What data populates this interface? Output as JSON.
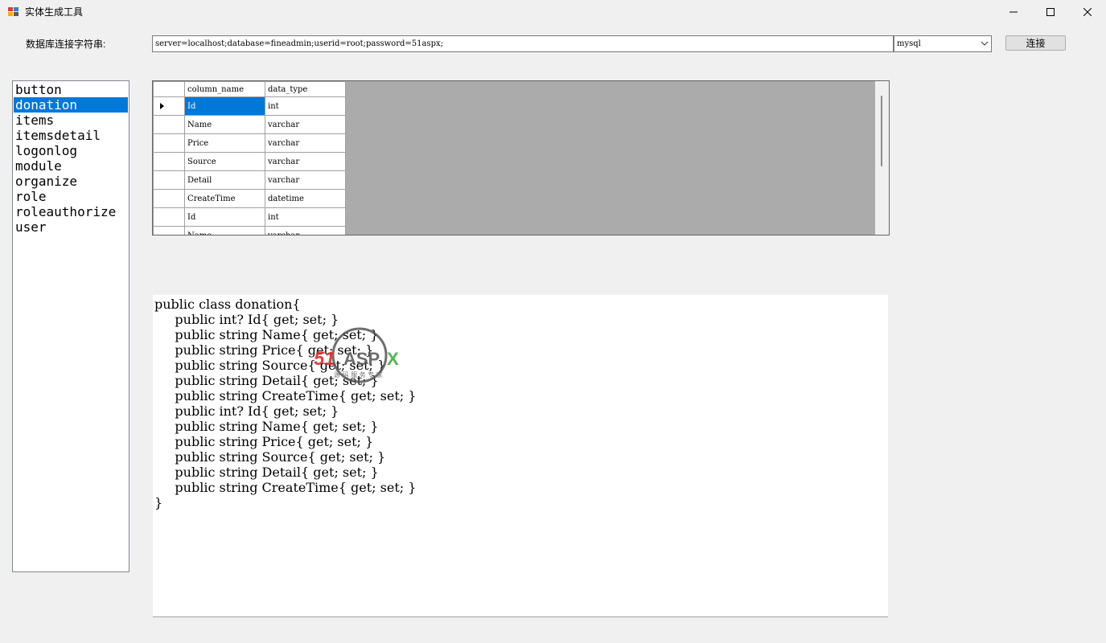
{
  "window": {
    "title": "实体生成工具",
    "controls": {
      "minimize": "minimize-icon",
      "maximize": "maximize-icon",
      "close": "close-icon"
    }
  },
  "connection": {
    "label": "数据库连接字符串:",
    "value": "server=localhost;database=fineadmin;userid=root;password=51aspx;",
    "db_type_selected": "mysql",
    "connect_label": "连接"
  },
  "tables": [
    "button",
    "donation",
    "items",
    "itemsdetail",
    "logonlog",
    "module",
    "organize",
    "role",
    "roleauthorize",
    "user"
  ],
  "selected_table": "donation",
  "grid": {
    "columns": [
      "column_name",
      "data_type"
    ],
    "rows": [
      {
        "column_name": "Id",
        "data_type": "int"
      },
      {
        "column_name": "Name",
        "data_type": "varchar"
      },
      {
        "column_name": "Price",
        "data_type": "varchar"
      },
      {
        "column_name": "Source",
        "data_type": "varchar"
      },
      {
        "column_name": "Detail",
        "data_type": "varchar"
      },
      {
        "column_name": "CreateTime",
        "data_type": "datetime"
      },
      {
        "column_name": "Id",
        "data_type": "int"
      },
      {
        "column_name": "Name",
        "data_type": "varchar"
      }
    ]
  },
  "generated_code": "public class donation{\n     public int? Id{ get; set; }\n     public string Name{ get; set; }\n     public string Price{ get; set; }\n     public string Source{ get; set; }\n     public string Detail{ get; set; }\n     public string CreateTime{ get; set; }\n     public int? Id{ get; set; }\n     public string Name{ get; set; }\n     public string Price{ get; set; }\n     public string Source{ get; set; }\n     public string Detail{ get; set; }\n     public string CreateTime{ get; set; }\n}",
  "watermark": {
    "brand": "51ASPX",
    "tagline": "源码服务专家"
  },
  "colors": {
    "selection": "#0078d7",
    "window_bg": "#f0f0f0",
    "grid_bg": "#ababab"
  }
}
